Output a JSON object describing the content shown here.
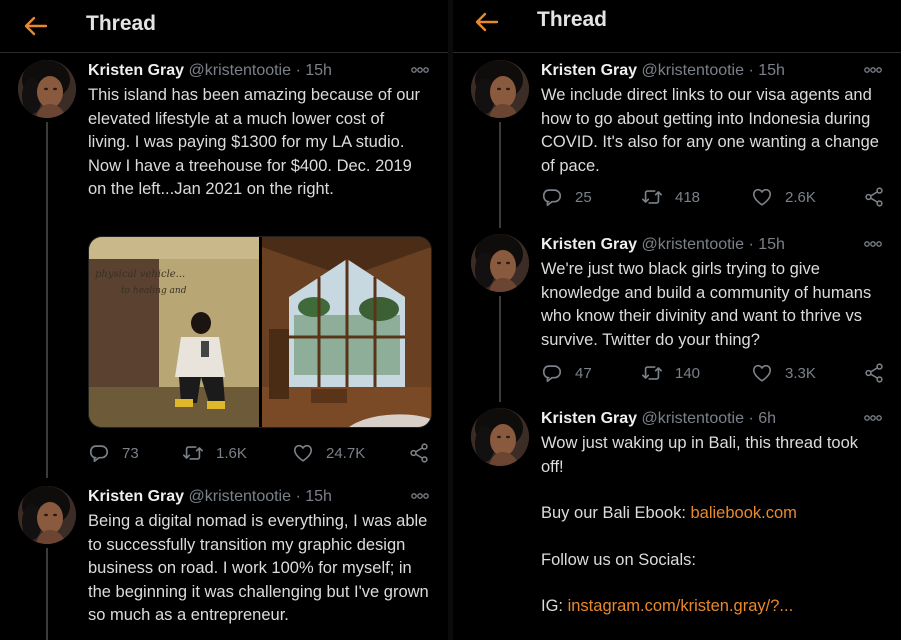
{
  "header": {
    "title": "Thread"
  },
  "user": {
    "name": "Kristen Gray",
    "handle": "@kristentootie"
  },
  "left": {
    "tweets": [
      {
        "time": "15h",
        "text": "This island has been amazing because of our elevated lifestyle at a much lower cost of living. I was paying $1300 for my LA studio. Now I have a treehouse for $400. Dec. 2019 on the left...Jan 2021 on the right.",
        "media": {
          "left_photo_text": "physical vehicle...",
          "left_photo_text2": "to healing and"
        },
        "stats": {
          "replies": "73",
          "retweets": "1.6K",
          "likes": "24.7K"
        }
      },
      {
        "time": "15h",
        "text": "Being a digital nomad is everything, I was able to successfully transition my graphic design business on road. I work 100% for myself; in the beginning it was challenging but I've grown so much as a entrepreneur."
      }
    ]
  },
  "right": {
    "tweets": [
      {
        "time": "15h",
        "text": "We include direct links to our visa agents and how to go about getting into Indonesia during COVID. It's also for any one wanting a change of pace.",
        "stats": {
          "replies": "25",
          "retweets": "418",
          "likes": "2.6K"
        }
      },
      {
        "time": "15h",
        "text": "We're just two black girls trying to give knowledge and build a community of humans who know their divinity and want to thrive vs survive. Twitter do your thing?",
        "stats": {
          "replies": "47",
          "retweets": "140",
          "likes": "3.3K"
        }
      },
      {
        "time": "6h",
        "text": "Wow just waking up in Bali, this thread took off!",
        "ebook_label": "Buy our Bali Ebook: ",
        "ebook_link": "baliebook.com",
        "follow_text": "Follow us on Socials:",
        "ig_label": "IG: ",
        "ig_link": "instagram.com/kristen.gray/?..."
      }
    ]
  },
  "separator": "·",
  "colors": {
    "accent": "#e8892d",
    "background": "#000000",
    "muted": "#7b8188",
    "divider": "#2b2b2b"
  },
  "icons": [
    "back-arrow-icon",
    "more-icon",
    "reply-icon",
    "retweet-icon",
    "like-icon",
    "share-icon"
  ]
}
